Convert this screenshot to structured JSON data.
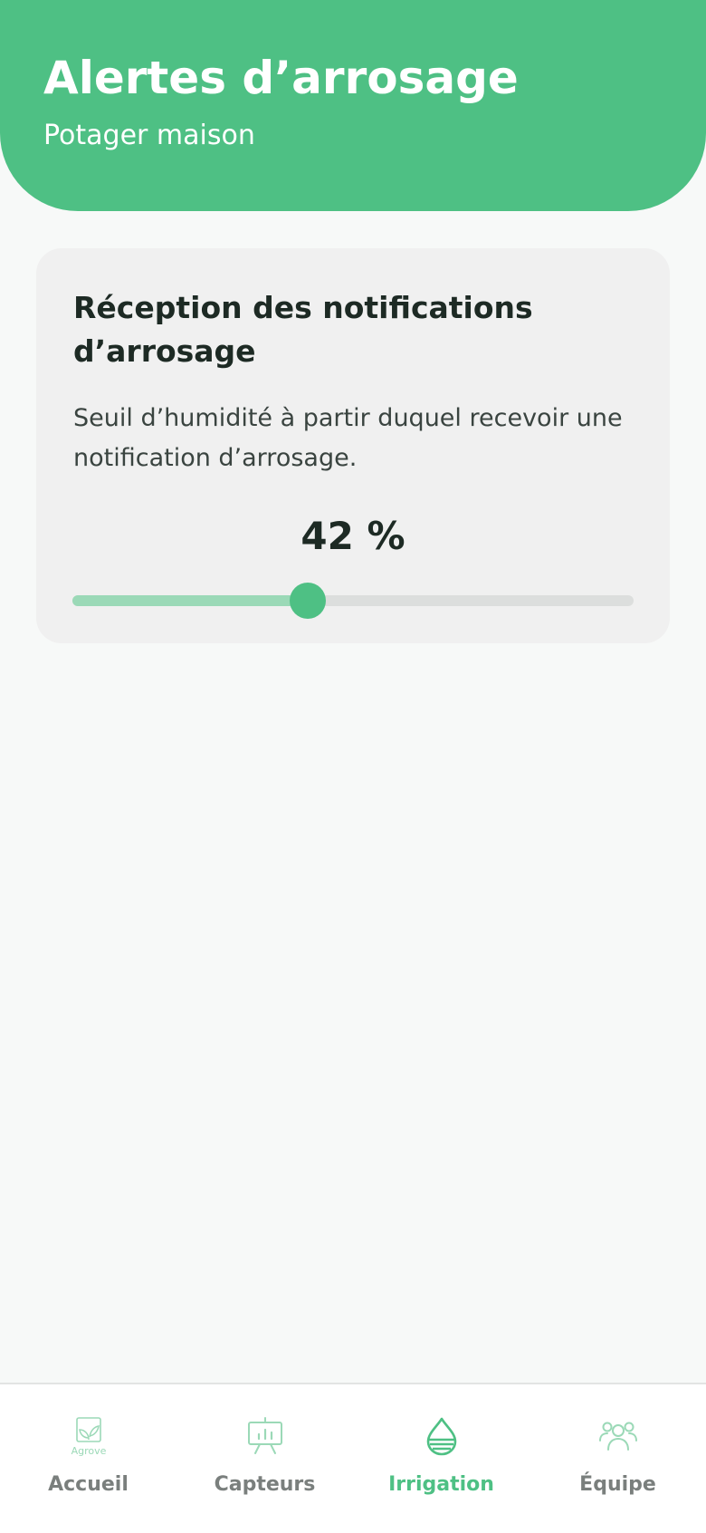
{
  "header": {
    "title": "Alertes d’arrosage",
    "subtitle": "Potager maison"
  },
  "card": {
    "title": "Réception des notifications d’arrosage",
    "description": "Seuil d’humidité à partir duquel recevoir une notification d’arrosage.",
    "value_label": "42 %",
    "slider_percent": 42
  },
  "colors": {
    "accent": "#4ec084",
    "accent_light": "#9bd9b7",
    "inactive": "#7a7f7d"
  },
  "nav": {
    "items": [
      {
        "label": "Accueil",
        "icon": "agrove-logo-icon",
        "logo_text": "Agrove",
        "active": false
      },
      {
        "label": "Capteurs",
        "icon": "sensor-chart-icon",
        "active": false
      },
      {
        "label": "Irrigation",
        "icon": "water-drop-icon",
        "active": true
      },
      {
        "label": "Équipe",
        "icon": "team-icon",
        "active": false
      }
    ]
  }
}
